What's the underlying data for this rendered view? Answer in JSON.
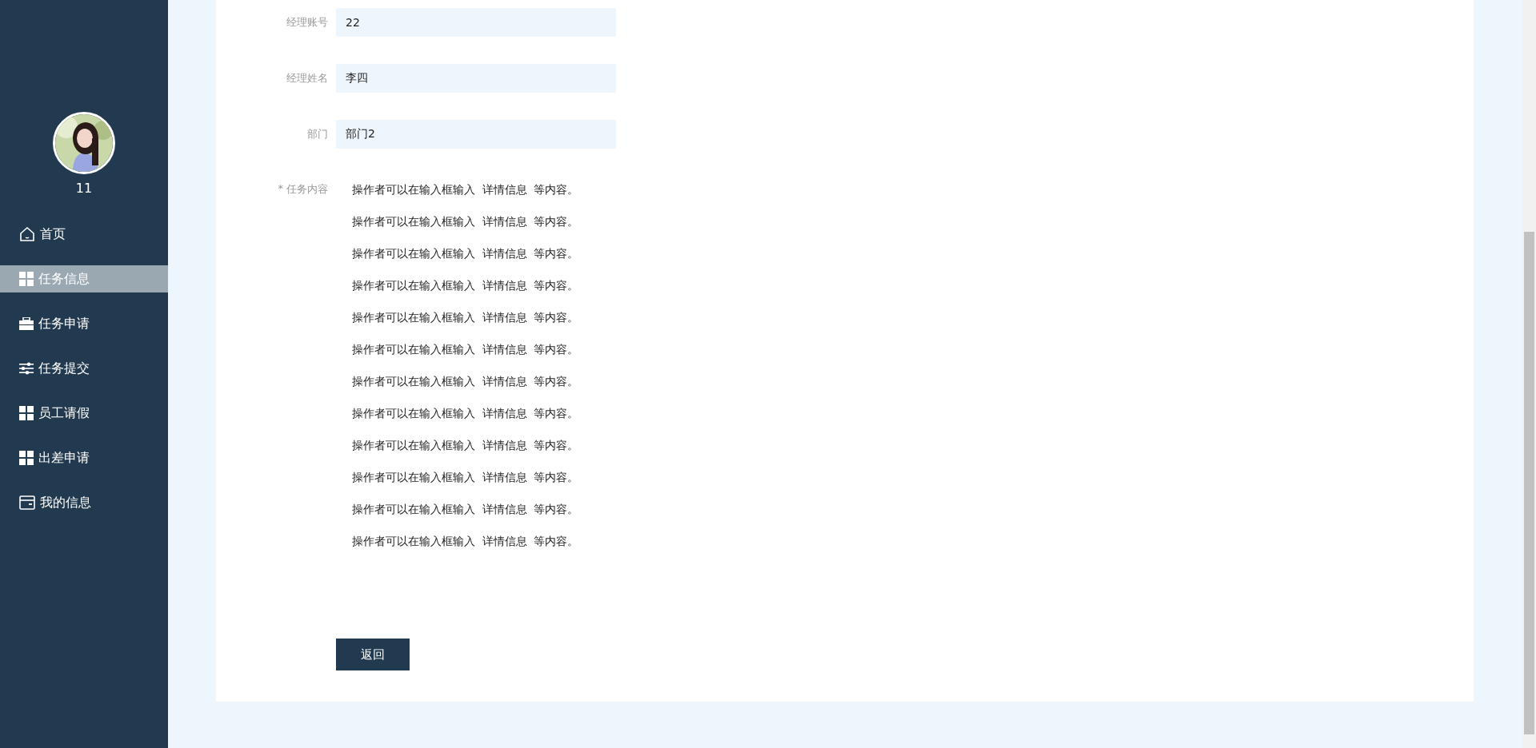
{
  "sidebar": {
    "username": "11",
    "items": [
      {
        "label": "首页",
        "selected": false
      },
      {
        "label": "任务信息",
        "selected": true
      },
      {
        "label": "任务申请",
        "selected": false
      },
      {
        "label": "任务提交",
        "selected": false
      },
      {
        "label": "员工请假",
        "selected": false
      },
      {
        "label": "出差申请",
        "selected": false
      },
      {
        "label": "我的信息",
        "selected": false
      }
    ]
  },
  "form": {
    "fields": [
      {
        "label": "经理账号",
        "value": "22"
      },
      {
        "label": "经理姓名",
        "value": "李四"
      },
      {
        "label": "部门",
        "value": "部门2"
      }
    ],
    "content": {
      "required_mark": "*",
      "label": "任务内容",
      "lines": [
        "操作者可以在输入框输入  详情信息  等内容。",
        "操作者可以在输入框输入  详情信息  等内容。",
        "操作者可以在输入框输入  详情信息  等内容。",
        "操作者可以在输入框输入  详情信息  等内容。",
        "操作者可以在输入框输入  详情信息  等内容。",
        "操作者可以在输入框输入  详情信息  等内容。",
        "操作者可以在输入框输入  详情信息  等内容。",
        "操作者可以在输入框输入  详情信息  等内容。",
        "操作者可以在输入框输入  详情信息  等内容。",
        "操作者可以在输入框输入  详情信息  等内容。",
        "操作者可以在输入框输入  详情信息  等内容。",
        "操作者可以在输入框输入  详情信息  等内容。"
      ]
    },
    "back_button": "返回"
  }
}
